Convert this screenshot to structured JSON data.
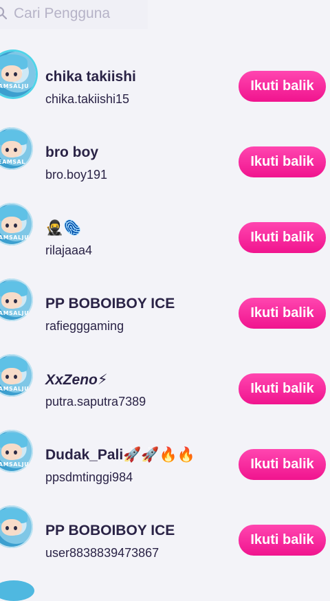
{
  "search": {
    "placeholder": "Cari Pengguna",
    "icon": "search-icon"
  },
  "colors": {
    "accent": "#f0148e",
    "background": "#f3f3f8",
    "text": "#2a2346",
    "placeholder": "#b6b3c7"
  },
  "users": [
    {
      "name": "chika takiishi",
      "username": "chika.takiishi15",
      "button": "Ikuti balik",
      "avatar_text": "EAMSALJU"
    },
    {
      "name": "bro boy",
      "username": "bro.boy191",
      "button": "Ikuti balik",
      "avatar_text": "EAMSAL"
    },
    {
      "name": "🥷🫆",
      "username": "rilajaaa4",
      "button": "Ikuti balik",
      "avatar_text": "EAMSALJU"
    },
    {
      "name": "PP BOBOIBOY ICE",
      "username": "rafiegggaming",
      "button": "Ikuti balik",
      "avatar_text": "EAMSALJU"
    },
    {
      "name": "XxZeno⚡",
      "username": "putra.saputra7389",
      "button": "Ikuti balik",
      "avatar_text": "EAMSALJU"
    },
    {
      "name": "Dudak_Pali🚀🚀🔥🔥",
      "username": "ppsdmtinggi984",
      "button": "Ikuti balik",
      "avatar_text": "EAMSALJU"
    },
    {
      "name": "PP BOBOIBOY ICE",
      "username": "user8838839473867",
      "button": "Ikuti balik",
      "avatar_text": ""
    }
  ]
}
